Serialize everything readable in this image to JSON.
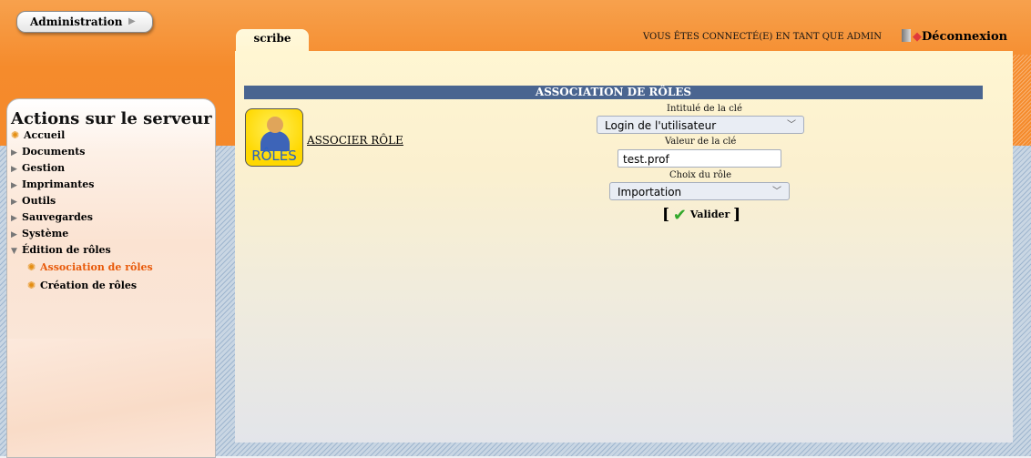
{
  "header": {
    "admin_label": "Administration",
    "tab_label": "scribe",
    "connected_text": "VOUS ÊTES CONNECTÉ(E) EN TANT QUE ADMIN",
    "logout_label": "Déconnexion"
  },
  "sidebar": {
    "title": "Actions sur le serveur",
    "items": [
      {
        "label": "Accueil",
        "icon": "sun-icon"
      },
      {
        "label": "Documents",
        "icon": "triangle-right-icon"
      },
      {
        "label": "Gestion",
        "icon": "triangle-right-icon"
      },
      {
        "label": "Imprimantes",
        "icon": "triangle-right-icon"
      },
      {
        "label": "Outils",
        "icon": "triangle-right-icon"
      },
      {
        "label": "Sauvegardes",
        "icon": "triangle-right-icon"
      },
      {
        "label": "Système",
        "icon": "triangle-right-icon"
      },
      {
        "label": "Édition de rôles",
        "icon": "triangle-down-icon"
      }
    ],
    "subitems": [
      {
        "label": "Association de rôles",
        "active": true
      },
      {
        "label": "Création de rôles",
        "active": false
      }
    ]
  },
  "main": {
    "section_title": "ASSOCIATION DE RÔLES",
    "role_icon_text": "RÔLES",
    "associate_link": "ASSOCIER RÔLE",
    "form": {
      "key_label": "Intitulé de la clé",
      "key_select": "Login de l'utilisateur",
      "value_label": "Valeur de la clé",
      "value_input": "test.prof",
      "role_label": "Choix du rôle",
      "role_select": "Importation",
      "submit_label": "Valider"
    }
  },
  "colors": {
    "banner": "#f58b2c",
    "section_bar": "#4a6590",
    "active_item": "#e85a0a"
  }
}
